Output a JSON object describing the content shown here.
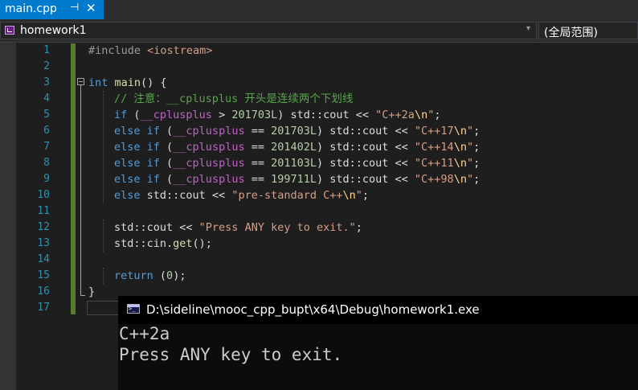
{
  "tab": {
    "title": "main.cpp",
    "pin_glyph": "⊣",
    "close_glyph": "✕"
  },
  "navbar": {
    "project": "homework1",
    "scope": "(全局范围)",
    "chevron_glyph": "▾"
  },
  "editor": {
    "line_numbers": [
      "1",
      "2",
      "3",
      "4",
      "5",
      "6",
      "7",
      "8",
      "9",
      "10",
      "11",
      "12",
      "13",
      "14",
      "15",
      "16",
      "17"
    ]
  },
  "code": {
    "l1": {
      "pre": "#include ",
      "hdr": "<iostream>"
    },
    "l3": {
      "kw": "int",
      "rest1": " ",
      "fn": "main",
      "rest2": "() {"
    },
    "l4": {
      "comment": "// 注意：__cplusplus 开头是连续两个下划线"
    },
    "l5": {
      "kw": "if",
      "p1": " (",
      "mac": "__cplusplus",
      "p2": " > ",
      "num": "201703L",
      "p3": ") std::cout << ",
      "s1": "\"C++2a",
      "esc": "\\n",
      "s2": "\"",
      "p4": ";"
    },
    "l6": {
      "kw": "else if",
      "p1": " (",
      "mac": "__cplusplus",
      "p2": " == ",
      "num": "201703L",
      "p3": ") std::cout << ",
      "s1": "\"C++17",
      "esc": "\\n",
      "s2": "\"",
      "p4": ";"
    },
    "l7": {
      "kw": "else if",
      "p1": " (",
      "mac": "__cplusplus",
      "p2": " == ",
      "num": "201402L",
      "p3": ") std::cout << ",
      "s1": "\"C++14",
      "esc": "\\n",
      "s2": "\"",
      "p4": ";"
    },
    "l8": {
      "kw": "else if",
      "p1": " (",
      "mac": "__cplusplus",
      "p2": " == ",
      "num": "201103L",
      "p3": ") std::cout << ",
      "s1": "\"C++11",
      "esc": "\\n",
      "s2": "\"",
      "p4": ";"
    },
    "l9": {
      "kw": "else if",
      "p1": " (",
      "mac": "__cplusplus",
      "p2": " == ",
      "num": "199711L",
      "p3": ") std::cout << ",
      "s1": "\"C++98",
      "esc": "\\n",
      "s2": "\"",
      "p4": ";"
    },
    "l10": {
      "kw": "else",
      "p1": " std::cout << ",
      "s1": "\"pre-standard C++",
      "esc": "\\n",
      "s2": "\"",
      "p4": ";"
    },
    "l12": {
      "p1": "std::cout << ",
      "str": "\"Press ANY key to exit.\"",
      "p2": ";"
    },
    "l13": {
      "p1": "std::cin.",
      "fn": "get",
      "p2": "();"
    },
    "l15": {
      "kw": "return",
      "p1": " (",
      "num": "0",
      "p2": ");"
    },
    "l16": {
      "p1": "}"
    }
  },
  "console": {
    "title": "D:\\sideline\\mooc_cpp_bupt\\x64\\Debug\\homework1.exe",
    "output": [
      "C++2a",
      "Press ANY key to exit."
    ]
  }
}
